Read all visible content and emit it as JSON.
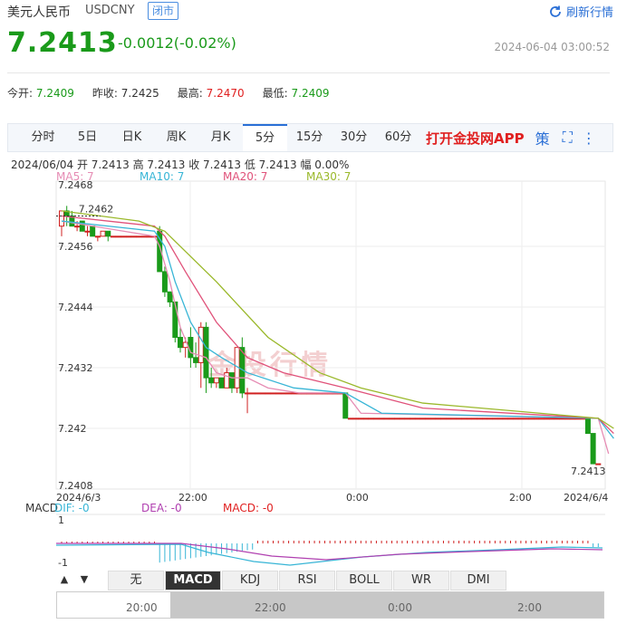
{
  "header": {
    "name": "美元人民币",
    "code": "USDCNY",
    "status": "闭市",
    "refresh": "刷新行情",
    "price": "7.2413",
    "change": "-0.0012(-0.02%)",
    "time": "2024-06-04 03:00:52"
  },
  "stats": [
    {
      "label": "今开:",
      "value": "7.2409",
      "color": "green"
    },
    {
      "label": "昨收:",
      "value": "7.2425",
      "color": "dark"
    },
    {
      "label": "最高:",
      "value": "7.2470",
      "color": "red"
    },
    {
      "label": "最低:",
      "value": "7.2409",
      "color": "green"
    }
  ],
  "tabs": [
    "分时",
    "5日",
    "日K",
    "周K",
    "月K",
    "5分",
    "15分",
    "30分",
    "60分"
  ],
  "active_tab": "5分",
  "app_link": "打开金投网APP",
  "policy_icon": "策",
  "ohlc_line": "2024/06/04  开 7.2413  高 7.2413  收 7.2413  低 7.2413  幅 0.00%",
  "ma": {
    "ma5": "MA5: 7",
    "ma10": "MA10: 7",
    "ma20": "MA20: 7",
    "ma30": "MA30: 7"
  },
  "macd_line": {
    "label": "MACD",
    "dif": "DIF: -0",
    "dea": "DEA: -0",
    "macd": "MACD: -0"
  },
  "indicator_tabs": [
    "无",
    "MACD",
    "KDJ",
    "RSI",
    "BOLL",
    "WR",
    "DMI"
  ],
  "active_indicator": "MACD",
  "navigator_labels": [
    "20:00",
    "22:00",
    "0:00",
    "2:00"
  ],
  "watermark": "金投行情",
  "chart_data": {
    "type": "candlestick",
    "y_ticks": [
      "7.2468",
      "7.2456",
      "7.2444",
      "7.2432",
      "7.242",
      "7.2408"
    ],
    "ylim": [
      7.2408,
      7.2468
    ],
    "x_ticks": [
      "2024/6/3",
      "22:00",
      "0:00",
      "2:00",
      "2024/6/4"
    ],
    "annotations": {
      "high": "7.2462",
      "last": "7.2413"
    },
    "macd_ticks": [
      "1",
      "-1"
    ],
    "candles": [
      [
        7.246,
        7.2463,
        7.2458,
        7.2463
      ],
      [
        7.2463,
        7.2464,
        7.246,
        7.2462
      ],
      [
        7.2462,
        7.2463,
        7.246,
        7.246
      ],
      [
        7.246,
        7.2461,
        7.2459,
        7.246
      ],
      [
        7.2461,
        7.2461,
        7.2459,
        7.2459
      ],
      [
        7.2459,
        7.246,
        7.2458,
        7.2459
      ],
      [
        7.246,
        7.246,
        7.2458,
        7.2458
      ],
      [
        7.2458,
        7.2458,
        7.2457,
        7.2458
      ],
      [
        7.2458,
        7.2459,
        7.2458,
        7.2459
      ],
      [
        7.2459,
        7.2459,
        7.2457,
        7.2458
      ],
      [
        7.2458,
        7.2458,
        7.2458,
        7.2458
      ],
      [
        7.2458,
        7.2458,
        7.2458,
        7.2458
      ],
      [
        7.2458,
        7.2458,
        7.2458,
        7.2458
      ],
      [
        7.2458,
        7.2458,
        7.2458,
        7.2458
      ],
      [
        7.2458,
        7.2458,
        7.2458,
        7.2458
      ],
      [
        7.2458,
        7.2458,
        7.2458,
        7.2458
      ],
      [
        7.2458,
        7.2458,
        7.2458,
        7.2458
      ],
      [
        7.2458,
        7.2458,
        7.2458,
        7.2458
      ],
      [
        7.2458,
        7.2458,
        7.2458,
        7.2458
      ],
      [
        7.2459,
        7.246,
        7.2451,
        7.2451
      ],
      [
        7.2451,
        7.2452,
        7.2446,
        7.2447
      ],
      [
        7.2447,
        7.2447,
        7.2444,
        7.2445
      ],
      [
        7.2445,
        7.2445,
        7.2437,
        7.2438
      ],
      [
        7.2438,
        7.244,
        7.2435,
        7.2436
      ],
      [
        7.2436,
        7.2438,
        7.2434,
        7.2437
      ],
      [
        7.2438,
        7.244,
        7.2432,
        7.2434
      ],
      [
        7.2434,
        7.2437,
        7.2432,
        7.2433
      ],
      [
        7.2433,
        7.2441,
        7.2428,
        7.244
      ],
      [
        7.244,
        7.2441,
        7.2427,
        7.243
      ],
      [
        7.243,
        7.2432,
        7.2428,
        7.2429
      ],
      [
        7.2429,
        7.243,
        7.2428,
        7.243
      ],
      [
        7.243,
        7.243,
        7.2428,
        7.2428
      ],
      [
        7.2428,
        7.2432,
        7.2428,
        7.2431
      ],
      [
        7.2431,
        7.2431,
        7.2427,
        7.2428
      ],
      [
        7.2428,
        7.2436,
        7.2427,
        7.2436
      ],
      [
        7.2436,
        7.2438,
        7.2426,
        7.2427
      ],
      [
        7.2427,
        7.2428,
        7.2423,
        7.2427
      ],
      [
        7.2427,
        7.2427,
        7.2427,
        7.2427
      ],
      [
        7.2427,
        7.2427,
        7.2427,
        7.2427
      ],
      [
        7.2427,
        7.2427,
        7.2427,
        7.2427
      ],
      [
        7.2427,
        7.2427,
        7.2427,
        7.2427
      ],
      [
        7.2427,
        7.2427,
        7.2427,
        7.2427
      ],
      [
        7.2427,
        7.2427,
        7.2427,
        7.2427
      ],
      [
        7.2427,
        7.2427,
        7.2427,
        7.2427
      ],
      [
        7.2427,
        7.2427,
        7.2427,
        7.2427
      ],
      [
        7.2427,
        7.2427,
        7.2427,
        7.2427
      ],
      [
        7.2427,
        7.2427,
        7.2427,
        7.2427
      ],
      [
        7.2427,
        7.2427,
        7.2427,
        7.2427
      ],
      [
        7.2427,
        7.2427,
        7.2427,
        7.2427
      ],
      [
        7.2427,
        7.2427,
        7.2427,
        7.2427
      ],
      [
        7.2427,
        7.2427,
        7.2427,
        7.2427
      ],
      [
        7.2427,
        7.2427,
        7.2427,
        7.2427
      ],
      [
        7.2427,
        7.2427,
        7.2427,
        7.2427
      ],
      [
        7.2427,
        7.2427,
        7.2427,
        7.2427
      ],
      [
        7.2427,
        7.2427,
        7.2427,
        7.2427
      ],
      [
        7.2427,
        7.2427,
        7.2422,
        7.2422
      ],
      [
        7.2422,
        7.2422,
        7.2422,
        7.2422
      ],
      [
        7.2422,
        7.2422,
        7.2422,
        7.2422
      ],
      [
        7.2422,
        7.2422,
        7.2422,
        7.2422
      ],
      [
        7.2422,
        7.2422,
        7.2422,
        7.2422
      ],
      [
        7.2422,
        7.2422,
        7.2422,
        7.2422
      ],
      [
        7.2422,
        7.2422,
        7.2422,
        7.2422
      ],
      [
        7.2422,
        7.2422,
        7.2422,
        7.2422
      ],
      [
        7.2422,
        7.2422,
        7.2422,
        7.2422
      ],
      [
        7.2422,
        7.2422,
        7.2422,
        7.2422
      ],
      [
        7.2422,
        7.2422,
        7.2422,
        7.2422
      ],
      [
        7.2422,
        7.2422,
        7.2422,
        7.2422
      ],
      [
        7.2422,
        7.2422,
        7.2422,
        7.2422
      ],
      [
        7.2422,
        7.2422,
        7.2422,
        7.2422
      ],
      [
        7.2422,
        7.2422,
        7.2422,
        7.2422
      ],
      [
        7.2422,
        7.2422,
        7.2422,
        7.2422
      ],
      [
        7.2422,
        7.2422,
        7.2422,
        7.2422
      ],
      [
        7.2422,
        7.2422,
        7.2422,
        7.2422
      ],
      [
        7.2422,
        7.2422,
        7.2422,
        7.2422
      ],
      [
        7.2422,
        7.2422,
        7.2422,
        7.2422
      ],
      [
        7.2422,
        7.2422,
        7.2422,
        7.2422
      ],
      [
        7.2422,
        7.2422,
        7.2422,
        7.2422
      ],
      [
        7.2422,
        7.2422,
        7.2422,
        7.2422
      ],
      [
        7.2422,
        7.2422,
        7.2422,
        7.2422
      ],
      [
        7.2422,
        7.2422,
        7.2422,
        7.2422
      ],
      [
        7.2422,
        7.2422,
        7.2422,
        7.2422
      ],
      [
        7.2422,
        7.2422,
        7.2422,
        7.2422
      ],
      [
        7.2422,
        7.2422,
        7.2422,
        7.2422
      ],
      [
        7.2422,
        7.2422,
        7.2422,
        7.2422
      ],
      [
        7.2422,
        7.2422,
        7.2422,
        7.2422
      ],
      [
        7.2422,
        7.2422,
        7.2422,
        7.2422
      ],
      [
        7.2422,
        7.2422,
        7.2422,
        7.2422
      ],
      [
        7.2422,
        7.2422,
        7.2422,
        7.2422
      ],
      [
        7.2422,
        7.2422,
        7.2422,
        7.2422
      ],
      [
        7.2422,
        7.2422,
        7.2422,
        7.2422
      ],
      [
        7.2422,
        7.2422,
        7.2422,
        7.2422
      ],
      [
        7.2422,
        7.2422,
        7.2422,
        7.2422
      ],
      [
        7.2422,
        7.2422,
        7.2422,
        7.2422
      ],
      [
        7.2422,
        7.2422,
        7.2422,
        7.2422
      ],
      [
        7.2422,
        7.2422,
        7.2422,
        7.2422
      ],
      [
        7.2422,
        7.2422,
        7.2422,
        7.2422
      ],
      [
        7.2422,
        7.2422,
        7.2422,
        7.2422
      ],
      [
        7.2422,
        7.2422,
        7.2422,
        7.2422
      ],
      [
        7.2422,
        7.2422,
        7.2422,
        7.2422
      ],
      [
        7.2422,
        7.2422,
        7.2422,
        7.2422
      ],
      [
        7.2422,
        7.2422,
        7.2422,
        7.2422
      ],
      [
        7.2422,
        7.2422,
        7.2422,
        7.2422
      ],
      [
        7.2422,
        7.2422,
        7.2419,
        7.2419
      ],
      [
        7.2419,
        7.2419,
        7.2413,
        7.2413
      ],
      [
        7.2413,
        7.2413,
        7.2413,
        7.2413
      ]
    ],
    "ma_lines": {
      "MA5": [
        [
          0,
          7.2461
        ],
        [
          18,
          7.2458
        ],
        [
          19,
          7.2456
        ],
        [
          21,
          7.2449
        ],
        [
          23,
          7.244
        ],
        [
          25,
          7.2435
        ],
        [
          28,
          7.2434
        ],
        [
          30,
          7.2431
        ],
        [
          33,
          7.243
        ],
        [
          36,
          7.243
        ],
        [
          40,
          7.2428
        ],
        [
          46,
          7.2427
        ],
        [
          55,
          7.2427
        ],
        [
          58,
          7.2423
        ],
        [
          104,
          7.2422
        ],
        [
          106,
          7.2415
        ]
      ],
      "MA10": [
        [
          0,
          7.2461
        ],
        [
          18,
          7.2459
        ],
        [
          20,
          7.2456
        ],
        [
          22,
          7.2449
        ],
        [
          25,
          7.2441
        ],
        [
          28,
          7.2436
        ],
        [
          31,
          7.2434
        ],
        [
          36,
          7.2431
        ],
        [
          45,
          7.2428
        ],
        [
          55,
          7.2427
        ],
        [
          62,
          7.2423
        ],
        [
          104,
          7.2422
        ],
        [
          107,
          7.2418
        ]
      ],
      "MA20": [
        [
          0,
          7.2462
        ],
        [
          18,
          7.246
        ],
        [
          20,
          7.2458
        ],
        [
          24,
          7.2451
        ],
        [
          30,
          7.2441
        ],
        [
          36,
          7.2434
        ],
        [
          43,
          7.2431
        ],
        [
          55,
          7.2428
        ],
        [
          70,
          7.2424
        ],
        [
          104,
          7.2422
        ],
        [
          107,
          7.2419
        ]
      ],
      "MA30": [
        [
          0,
          7.2463
        ],
        [
          15,
          7.2461
        ],
        [
          20,
          7.2459
        ],
        [
          30,
          7.2449
        ],
        [
          40,
          7.2438
        ],
        [
          50,
          7.2431
        ],
        [
          58,
          7.2428
        ],
        [
          70,
          7.2425
        ],
        [
          104,
          7.2422
        ],
        [
          107,
          7.242
        ]
      ]
    }
  }
}
